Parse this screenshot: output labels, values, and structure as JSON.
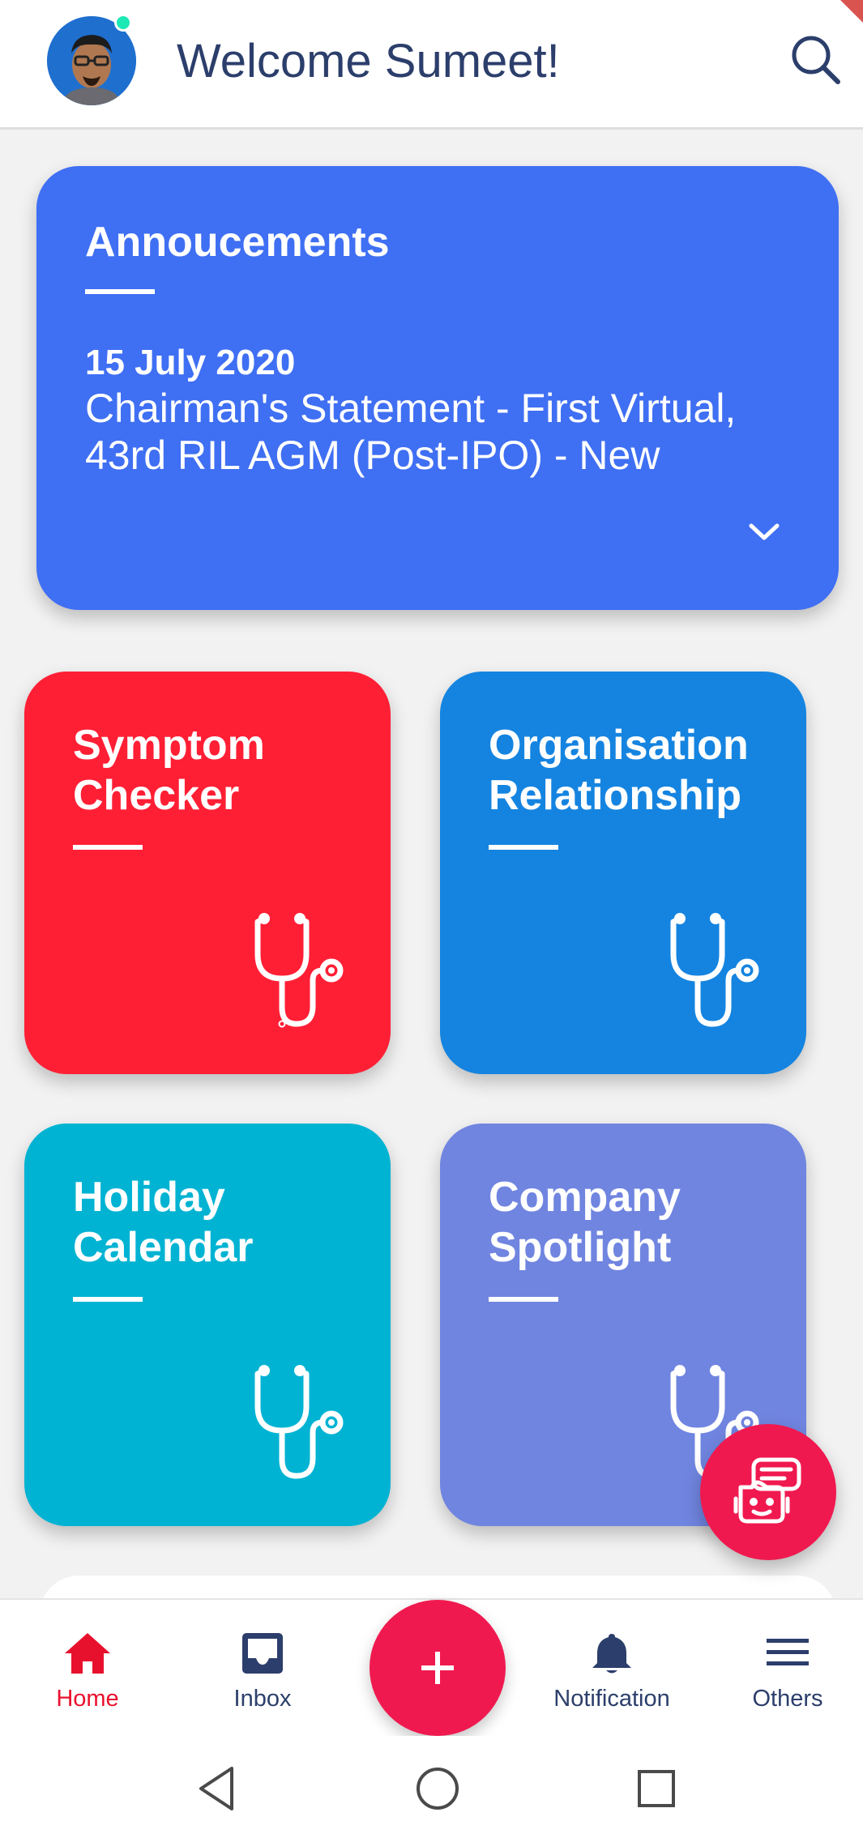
{
  "header": {
    "welcome_text": "Welcome Sumeet!",
    "avatar_icon": "user-avatar",
    "status": "online",
    "search_icon": "search-icon"
  },
  "announcement": {
    "title": "Annoucements",
    "date": "15 July 2020",
    "text": "Chairman's Statement - First Virtual, 43rd RIL AGM (Post-IPO) - New",
    "expand_icon": "chevron-down-icon"
  },
  "tiles": [
    {
      "title": "Symptom Checker",
      "color": "#ff1f35",
      "icon": "stethoscope-icon"
    },
    {
      "title": "Organisation Relationship",
      "color": "#1584e0",
      "icon": "stethoscope-icon"
    },
    {
      "title": "Holiday Calendar",
      "color": "#00b3d3",
      "icon": "stethoscope-icon"
    },
    {
      "title": "Company Spotlight",
      "color": "#7085e0",
      "icon": "stethoscope-icon"
    }
  ],
  "chatbot": {
    "icon": "robot-icon",
    "color": "#f0194f"
  },
  "bottom_nav": {
    "items": [
      {
        "label": "Home",
        "icon": "home-icon",
        "active": true
      },
      {
        "label": "Inbox",
        "icon": "inbox-icon",
        "active": false
      },
      {
        "label": "Notification",
        "icon": "bell-icon",
        "active": false
      },
      {
        "label": "Others",
        "icon": "menu-icon",
        "active": false
      }
    ],
    "fab_icon": "plus-icon",
    "active_color": "#e8112d"
  },
  "system_nav": [
    "back-icon",
    "home-circle-icon",
    "recents-icon"
  ]
}
